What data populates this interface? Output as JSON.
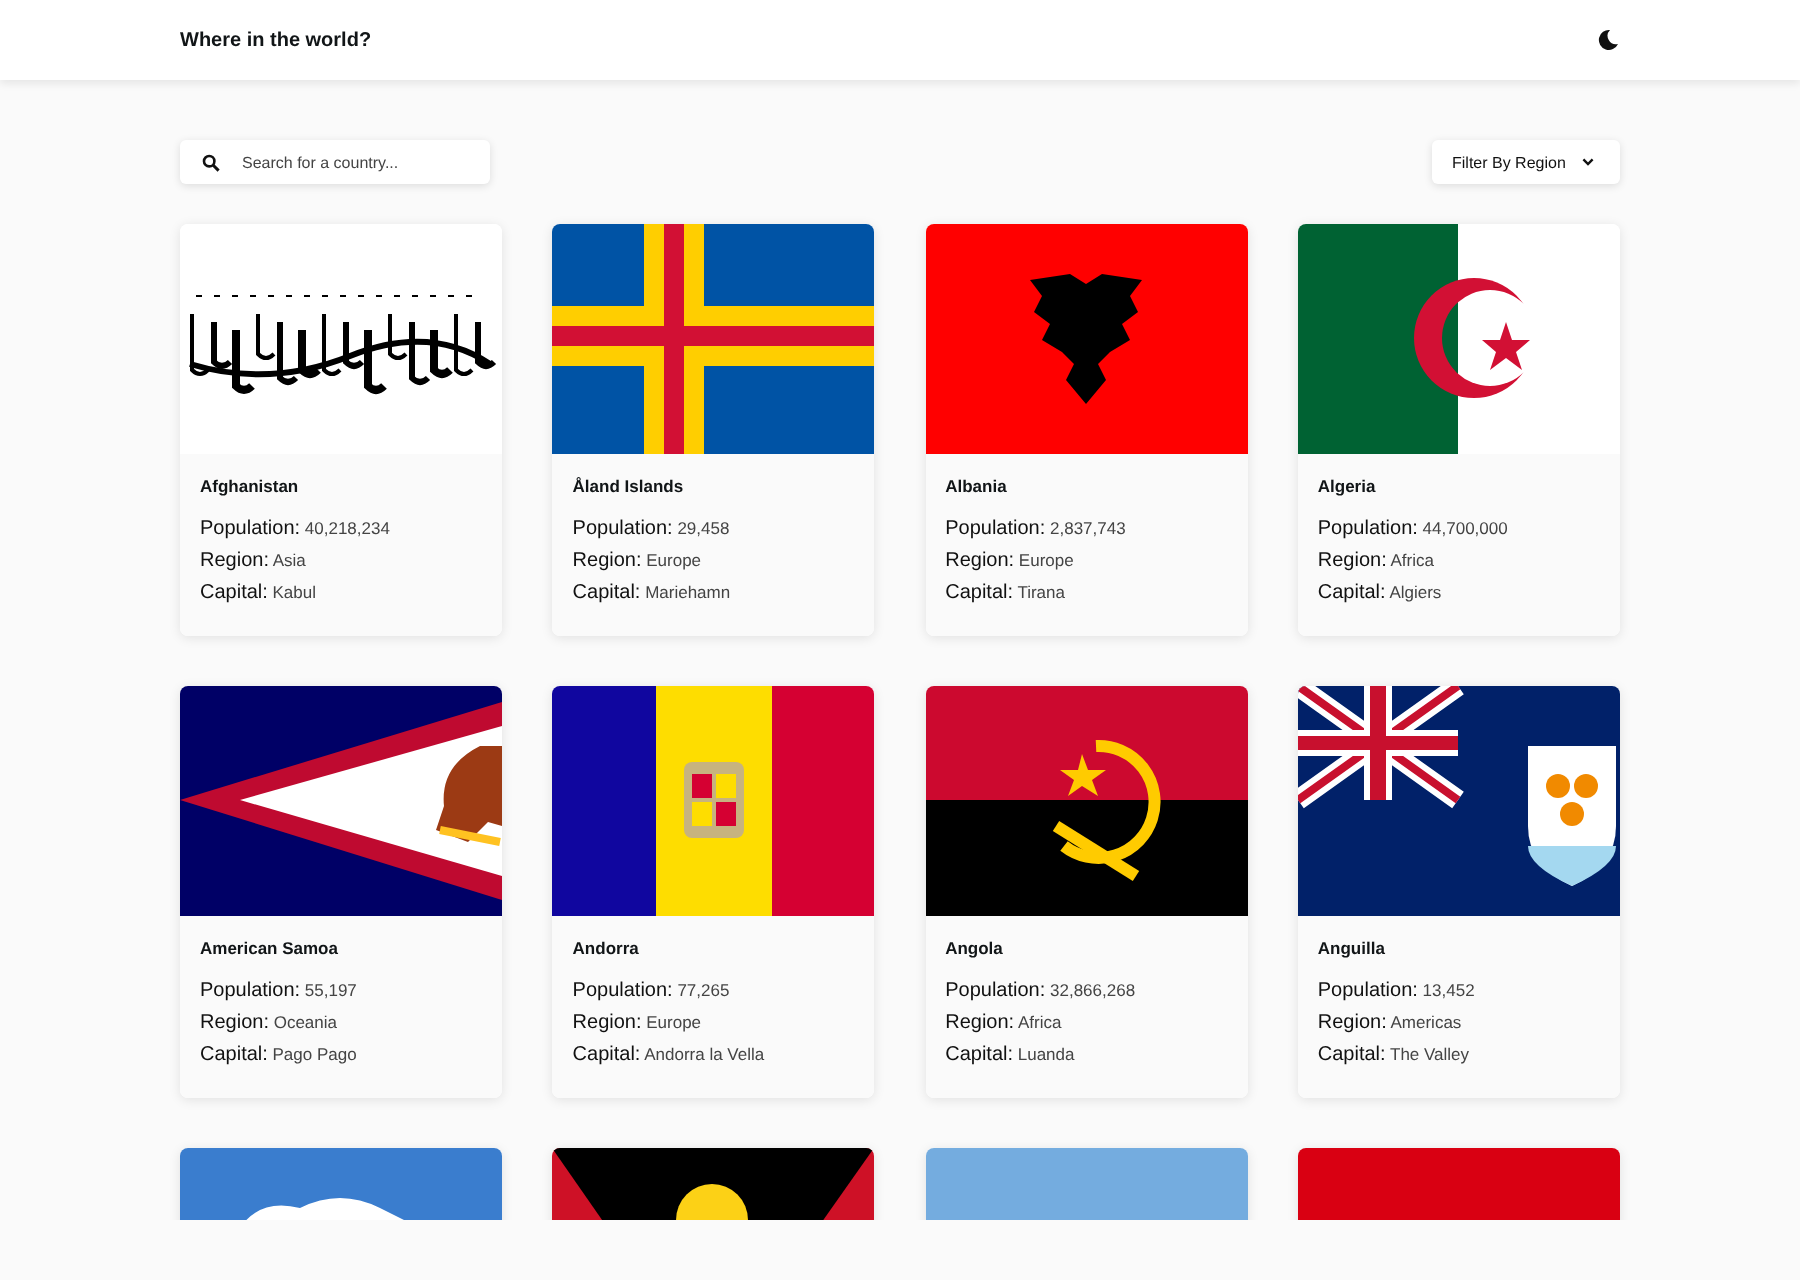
{
  "header": {
    "title": "Where in the world?"
  },
  "search": {
    "placeholder": "Search for a country..."
  },
  "filter": {
    "label": "Filter By Region"
  },
  "countries": [
    {
      "kind": "afghanistan",
      "name": "Afghanistan",
      "fields": [
        {
          "label": "Population:",
          "value": "40,218,234"
        },
        {
          "label": "Region:",
          "value": "Asia"
        },
        {
          "label": "Capital:",
          "value": "Kabul"
        }
      ]
    },
    {
      "kind": "aland",
      "name": "Åland Islands",
      "fields": [
        {
          "label": "Population:",
          "value": "29,458"
        },
        {
          "label": "Region:",
          "value": "Europe"
        },
        {
          "label": "Capital:",
          "value": "Mariehamn"
        }
      ]
    },
    {
      "kind": "albania",
      "name": "Albania",
      "fields": [
        {
          "label": "Population:",
          "value": "2,837,743"
        },
        {
          "label": "Region:",
          "value": "Europe"
        },
        {
          "label": "Capital:",
          "value": "Tirana"
        }
      ]
    },
    {
      "kind": "algeria",
      "name": "Algeria",
      "fields": [
        {
          "label": "Population:",
          "value": "44,700,000"
        },
        {
          "label": "Region:",
          "value": "Africa"
        },
        {
          "label": "Capital:",
          "value": "Algiers"
        }
      ]
    },
    {
      "kind": "samoa",
      "name": "American Samoa",
      "fields": [
        {
          "label": "Population:",
          "value": "55,197"
        },
        {
          "label": "Region:",
          "value": "Oceania"
        },
        {
          "label": "Capital:",
          "value": "Pago Pago"
        }
      ]
    },
    {
      "kind": "andorra",
      "name": "Andorra",
      "fields": [
        {
          "label": "Population:",
          "value": "77,265"
        },
        {
          "label": "Region:",
          "value": "Europe"
        },
        {
          "label": "Capital:",
          "value": "Andorra la Vella"
        }
      ]
    },
    {
      "kind": "angola",
      "name": "Angola",
      "fields": [
        {
          "label": "Population:",
          "value": "32,866,268"
        },
        {
          "label": "Region:",
          "value": "Africa"
        },
        {
          "label": "Capital:",
          "value": "Luanda"
        }
      ]
    },
    {
      "kind": "anguilla",
      "name": "Anguilla",
      "fields": [
        {
          "label": "Population:",
          "value": "13,452"
        },
        {
          "label": "Region:",
          "value": "Americas"
        },
        {
          "label": "Capital:",
          "value": "The Valley"
        }
      ]
    },
    {
      "kind": "antarctica"
    },
    {
      "kind": "antigua"
    },
    {
      "kind": "argentina"
    },
    {
      "kind": "armenia"
    }
  ]
}
